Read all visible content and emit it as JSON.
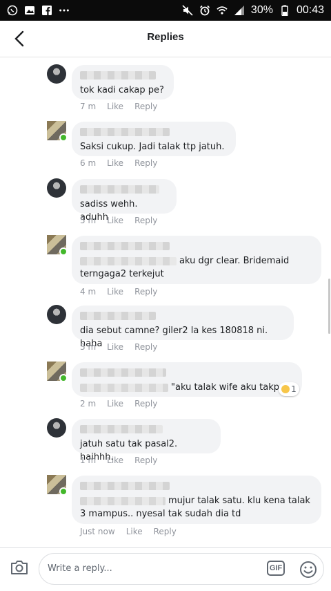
{
  "status_bar": {
    "battery": "30%",
    "time": "00:43",
    "left_icons": [
      "whatsapp-icon",
      "image-icon",
      "facebook-icon",
      "more-icon"
    ],
    "right_icons": [
      "mute-icon",
      "alarm-icon",
      "wifi-icon",
      "signal-icon",
      "battery-icon"
    ]
  },
  "header": {
    "title": "Replies"
  },
  "comments": [
    {
      "text": "tok kadi cakap pe?",
      "time": "7 m",
      "like": "Like",
      "reply": "Reply"
    },
    {
      "text": "Saksi cukup. Jadi talak ttp jatuh.",
      "time": "6 m",
      "like": "Like",
      "reply": "Reply"
    },
    {
      "text": "sadiss wehh. aduhh",
      "time": "5 m",
      "like": "Like",
      "reply": "Reply"
    },
    {
      "text": "aku dgr clear. Bridemaid",
      "text2": "terngaga2 terkejut",
      "time": "4 m",
      "like": "Like",
      "reply": "Reply"
    },
    {
      "text": "dia sebut camne? giler2 la kes 180818 ni. haha",
      "time": "3 m",
      "like": "Like",
      "reply": "Reply"
    },
    {
      "text": "\"aku talak wife aku takpe\"",
      "time": "2 m",
      "like": "Like",
      "reply": "Reply",
      "reaction": "1"
    },
    {
      "text": "jatuh satu tak pasal2. haihhh.",
      "time": "1 m",
      "like": "Like",
      "reply": "Reply"
    },
    {
      "text": "mujur talak satu. klu kena talak",
      "text2": "3 mampus.. nyesal tak sudah dia td",
      "time": "Just now",
      "like": "Like",
      "reply": "Reply"
    }
  ],
  "composer": {
    "placeholder": "Write a reply...",
    "gif": "GIF"
  },
  "colors": {
    "bubble": "#f2f3f5",
    "meta": "#90949c",
    "online": "#42b72a",
    "status_bar": "#0b0b0b"
  }
}
